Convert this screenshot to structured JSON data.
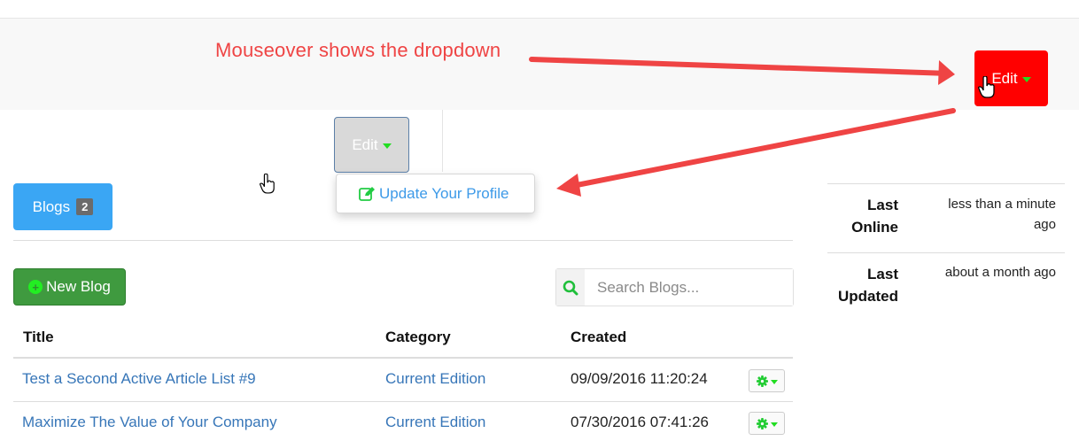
{
  "annotation": {
    "text": "Mouseover shows the dropdown",
    "color": "#ef4444"
  },
  "edit_buttons": {
    "red_label": "Edit",
    "gray_label": "Edit"
  },
  "dropdown": {
    "item_label": "Update Your Profile",
    "item_icon": "edit-square-icon"
  },
  "blogs_button": {
    "label": "Blogs",
    "count": "2"
  },
  "new_blog_button": {
    "label": "New Blog",
    "icon": "plus-circle-icon"
  },
  "search": {
    "placeholder": "Search Blogs...",
    "value": ""
  },
  "table": {
    "headers": {
      "title": "Title",
      "category": "Category",
      "created": "Created"
    },
    "rows": [
      {
        "title": "Test a Second Active Article List #9",
        "category": "Current Edition",
        "created": "09/09/2016 11:20:24"
      },
      {
        "title": "Maximize The Value of Your Company",
        "category": "Current Edition",
        "created": "07/30/2016 07:41:26"
      }
    ]
  },
  "sidebar": {
    "last_online_label_1": "Last",
    "last_online_label_2": "Online",
    "last_online_value_1": "less than a minute",
    "last_online_value_2": "ago",
    "last_updated_label_1": "Last",
    "last_updated_label_2": "Updated",
    "last_updated_value": "about a month ago"
  },
  "colors": {
    "accent_blue": "#3aa6f4",
    "link_blue": "#3776b8",
    "success_green": "#3f9a3f",
    "annotation_red": "#ef4444",
    "edit_red": "#ff0000"
  }
}
